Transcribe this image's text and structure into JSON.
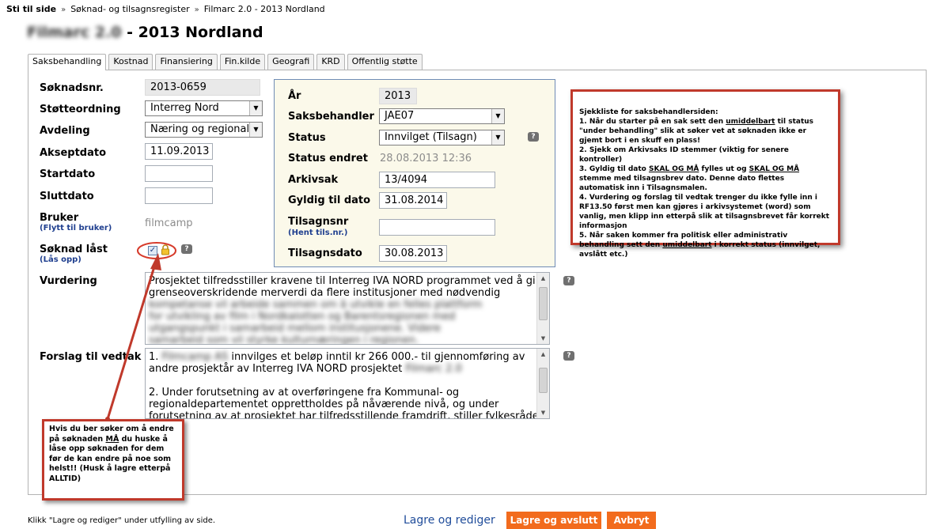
{
  "breadcrumb": {
    "items": [
      "Sti til side",
      "Søknad- og tilsagnsregister",
      "Filmarc 2.0 - 2013 Nordland"
    ],
    "separator": "»"
  },
  "page_title": {
    "obscured_part": "Filmarc 2.0",
    "text": "- 2013 Nordland"
  },
  "tabs": [
    "Saksbehandling",
    "Kostnad",
    "Finansiering",
    "Fin.kilde",
    "Geografi",
    "KRD",
    "Offentlig støtte"
  ],
  "left_form": {
    "soknadsnr": {
      "label": "Søknadsnr.",
      "value": "2013-0659"
    },
    "stotteordning": {
      "label": "Støtteordning",
      "value": "Interreg Nord"
    },
    "avdeling": {
      "label": "Avdeling",
      "value": "Næring og regionalu"
    },
    "akseptdato": {
      "label": "Akseptdato",
      "value": "11.09.2013"
    },
    "startdato": {
      "label": "Startdato",
      "value": ""
    },
    "sluttdato": {
      "label": "Sluttdato",
      "value": ""
    },
    "bruker": {
      "label": "Bruker",
      "link": "(Flytt til bruker)",
      "value": "filmcamp"
    },
    "soknad_last": {
      "label": "Søknad låst",
      "link": "(Lås opp)",
      "checked": true
    },
    "vurdering": {
      "label": "Vurdering"
    },
    "forslag": {
      "label": "Forslag til vedtak"
    }
  },
  "right_box": {
    "ar": {
      "label": "År",
      "value": "2013"
    },
    "saksbehandler": {
      "label": "Saksbehandler",
      "value": "JAE07"
    },
    "status": {
      "label": "Status",
      "value": "Innvilget (Tilsagn)"
    },
    "status_endret": {
      "label": "Status endret",
      "value": "28.08.2013 12:36"
    },
    "arkivsak": {
      "label": "Arkivsak",
      "value": "13/4094"
    },
    "gyldig_til": {
      "label": "Gyldig til dato",
      "value": "31.08.2014"
    },
    "tilsagnsnr": {
      "label": "Tilsagnsnr",
      "link": "(Hent tils.nr.)",
      "value": ""
    },
    "tilsagnsdato": {
      "label": "Tilsagnsdato",
      "value": "30.08.2013"
    }
  },
  "vurdering_text": {
    "line1": "Prosjektet tilfredsstiller kravene til Interreg IVA NORD programmet ved å gi",
    "line2": "grenseoverskridende merverdi da flere institusjoner med nødvendig",
    "obscured_lines": [
      "kompetanse vil arbeide sammen om å utvikle en felles plattform",
      "for utvikling av film i Nordkalotten og Barentsregionen med",
      "utgangspunkt i samarbeid mellom institusjonene. Videre",
      "samarbeid som vil styrke kulturnæringen i regionen."
    ]
  },
  "forslag_text": {
    "line1_pre": "1.",
    "line1_obscured": "Filmcamp AS",
    "line1_post": "innvilges et beløp inntil kr 266 000.- til gjennomføring av",
    "line2_pre": "andre prosjektår av Interreg IVA NORD prosjektet",
    "line2_obscured": "Filmarc 2.0",
    "line3": "2. Under forutsetning av at overføringene fra Kommunal- og",
    "line4": "regionaldepartementet opprettholdes på nåværende nivå, og under",
    "line5": "forutsetning av at prosjektet har tilfredsstillende framdrift, stiller fylkesråden i"
  },
  "checklist_note": {
    "title": "Sjekkliste for saksbehandlersiden:",
    "i1a": "1. Når du starter på en sak sett den ",
    "i1u": "umiddelbart",
    "i1b": " til status \"under behandling\" slik at søker vet at søknaden ikke er gjemt bort i en skuff en plass!",
    "i2": "2. Sjekk om Arkivsaks ID stemmer (viktig for senere kontroller)",
    "i3a": "3. Gyldig til dato ",
    "i3u1": "SKAL OG MÅ",
    "i3b": " fylles ut og ",
    "i3u2": "SKAL OG MÅ",
    "i3c": " stemme med tilsagnsbrev dato. Denne dato flettes automatisk inn i Tilsagnsmalen.",
    "i4": "4. Vurdering og forslag til vedtak trenger du ikke fylle inn i RF13.50 først men kan gjøres i arkivsystemet (word) som vanlig, men klipp inn etterpå slik at tilsagnsbrevet får korrekt informasjon",
    "i5a": "5. Når saken kommer fra politisk eller administrativ behandling sett den ",
    "i5u": "umiddelbart",
    "i5b": " i korrekt status (innvilget, avslått etc.)"
  },
  "lock_note": {
    "a": "Hvis du ber søker om å endre på søknaden ",
    "u": "MÅ",
    "b": " du huske å låse opp søknaden for dem før de kan endre på noe som helst!! (Husk å lagre etterpå ALLTID)"
  },
  "footer": {
    "hint": "Klikk \"Lagre og rediger\" under utfylling av side.",
    "save_edit": "Lagre og rediger",
    "save_close": "Lagre og avslutt",
    "cancel": "Avbryt"
  },
  "colors": {
    "accent": "#f26b1d",
    "annotation": "#c0392b",
    "box_bg": "#fbf9ea",
    "link": "#1f3f8f"
  },
  "icons": [
    "help-icon",
    "lock-icon",
    "dropdown-arrow-icon",
    "checkbox-icon"
  ]
}
